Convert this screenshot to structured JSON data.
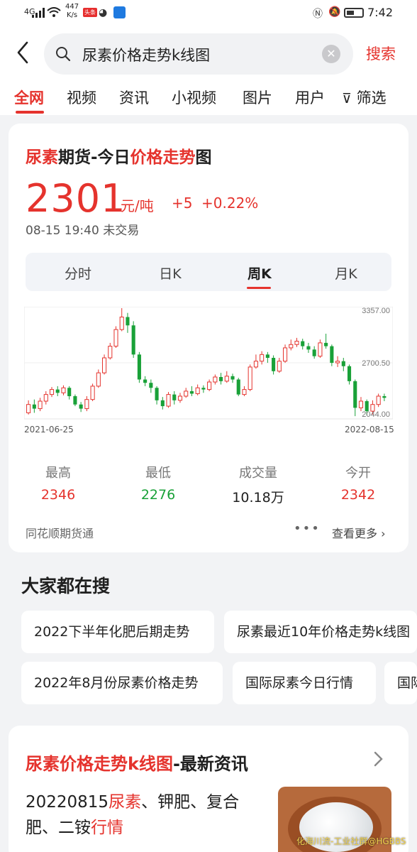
{
  "status_bar": {
    "signal_label": "4G",
    "speed_value": "447",
    "speed_unit": "K/s",
    "badge": "头条",
    "time": "7:42"
  },
  "search": {
    "query": "尿素价格走势k线图",
    "button": "搜索"
  },
  "tabs": [
    "全网",
    "视频",
    "资讯",
    "小视频",
    "图片",
    "用户"
  ],
  "filter_label": "筛选",
  "quote_card": {
    "title_parts": [
      "尿素",
      "期货-今日",
      "价格走势",
      "图"
    ],
    "price": "2301",
    "unit": "元/吨",
    "change": "+5",
    "change_pct": "+0.22%",
    "timestamp": "08-15 19:40 未交易",
    "segments": [
      "分时",
      "日K",
      "周K",
      "月K"
    ],
    "active_segment": "周K",
    "source": "同花顺期货通",
    "more": "查看更多",
    "stats": [
      {
        "label": "最高",
        "value": "2346",
        "color": "red"
      },
      {
        "label": "最低",
        "value": "2276",
        "color": "green"
      },
      {
        "label": "成交量",
        "value": "10.18万",
        "color": "black"
      },
      {
        "label": "今开",
        "value": "2342",
        "color": "red"
      }
    ]
  },
  "chart_data": {
    "type": "candlestick",
    "x_start": "2021-06-25",
    "x_end": "2022-08-15",
    "y_ticks": [
      "3357.00",
      "2700.50",
      "2044.00"
    ],
    "ylim": [
      2044,
      3357
    ],
    "colors": {
      "up": "#e5332d",
      "down": "#19a138"
    },
    "candles": [
      {
        "o": 2100,
        "c": 2200,
        "h": 2250,
        "l": 2080
      },
      {
        "o": 2200,
        "c": 2150,
        "h": 2260,
        "l": 2100
      },
      {
        "o": 2150,
        "c": 2240,
        "h": 2280,
        "l": 2120
      },
      {
        "o": 2240,
        "c": 2320,
        "h": 2360,
        "l": 2200
      },
      {
        "o": 2320,
        "c": 2380,
        "h": 2410,
        "l": 2290
      },
      {
        "o": 2380,
        "c": 2340,
        "h": 2420,
        "l": 2300
      },
      {
        "o": 2340,
        "c": 2400,
        "h": 2430,
        "l": 2310
      },
      {
        "o": 2400,
        "c": 2300,
        "h": 2420,
        "l": 2260
      },
      {
        "o": 2300,
        "c": 2200,
        "h": 2320,
        "l": 2180
      },
      {
        "o": 2200,
        "c": 2150,
        "h": 2230,
        "l": 2110
      },
      {
        "o": 2150,
        "c": 2260,
        "h": 2300,
        "l": 2120
      },
      {
        "o": 2260,
        "c": 2420,
        "h": 2450,
        "l": 2240
      },
      {
        "o": 2420,
        "c": 2580,
        "h": 2620,
        "l": 2400
      },
      {
        "o": 2580,
        "c": 2760,
        "h": 2800,
        "l": 2560
      },
      {
        "o": 2760,
        "c": 2900,
        "h": 2940,
        "l": 2740
      },
      {
        "o": 2900,
        "c": 3100,
        "h": 3140,
        "l": 2880
      },
      {
        "o": 3100,
        "c": 3250,
        "h": 3357,
        "l": 3080
      },
      {
        "o": 3250,
        "c": 3150,
        "h": 3300,
        "l": 3060
      },
      {
        "o": 3150,
        "c": 2800,
        "h": 3200,
        "l": 2760
      },
      {
        "o": 2800,
        "c": 2500,
        "h": 2830,
        "l": 2460
      },
      {
        "o": 2500,
        "c": 2460,
        "h": 2540,
        "l": 2420
      },
      {
        "o": 2460,
        "c": 2400,
        "h": 2500,
        "l": 2340
      },
      {
        "o": 2400,
        "c": 2250,
        "h": 2420,
        "l": 2200
      },
      {
        "o": 2250,
        "c": 2180,
        "h": 2290,
        "l": 2140
      },
      {
        "o": 2180,
        "c": 2320,
        "h": 2350,
        "l": 2160
      },
      {
        "o": 2320,
        "c": 2250,
        "h": 2360,
        "l": 2200
      },
      {
        "o": 2250,
        "c": 2300,
        "h": 2340,
        "l": 2220
      },
      {
        "o": 2300,
        "c": 2360,
        "h": 2400,
        "l": 2280
      },
      {
        "o": 2360,
        "c": 2330,
        "h": 2420,
        "l": 2300
      },
      {
        "o": 2330,
        "c": 2400,
        "h": 2440,
        "l": 2310
      },
      {
        "o": 2400,
        "c": 2380,
        "h": 2430,
        "l": 2340
      },
      {
        "o": 2380,
        "c": 2470,
        "h": 2500,
        "l": 2360
      },
      {
        "o": 2470,
        "c": 2530,
        "h": 2560,
        "l": 2440
      },
      {
        "o": 2530,
        "c": 2480,
        "h": 2580,
        "l": 2440
      },
      {
        "o": 2480,
        "c": 2540,
        "h": 2600,
        "l": 2460
      },
      {
        "o": 2540,
        "c": 2500,
        "h": 2570,
        "l": 2460
      },
      {
        "o": 2500,
        "c": 2320,
        "h": 2520,
        "l": 2300
      },
      {
        "o": 2320,
        "c": 2380,
        "h": 2420,
        "l": 2300
      },
      {
        "o": 2380,
        "c": 2650,
        "h": 2680,
        "l": 2360
      },
      {
        "o": 2650,
        "c": 2720,
        "h": 2800,
        "l": 2630
      },
      {
        "o": 2720,
        "c": 2800,
        "h": 2840,
        "l": 2680
      },
      {
        "o": 2800,
        "c": 2760,
        "h": 2830,
        "l": 2700
      },
      {
        "o": 2760,
        "c": 2600,
        "h": 2790,
        "l": 2560
      },
      {
        "o": 2600,
        "c": 2720,
        "h": 2760,
        "l": 2580
      },
      {
        "o": 2720,
        "c": 2880,
        "h": 2920,
        "l": 2700
      },
      {
        "o": 2880,
        "c": 2920,
        "h": 2980,
        "l": 2850
      },
      {
        "o": 2920,
        "c": 2960,
        "h": 3000,
        "l": 2890
      },
      {
        "o": 2960,
        "c": 2900,
        "h": 2990,
        "l": 2860
      },
      {
        "o": 2900,
        "c": 2860,
        "h": 2940,
        "l": 2820
      },
      {
        "o": 2860,
        "c": 2780,
        "h": 2900,
        "l": 2750
      },
      {
        "o": 2780,
        "c": 2940,
        "h": 2980,
        "l": 2760
      },
      {
        "o": 2940,
        "c": 2900,
        "h": 3050,
        "l": 2870
      },
      {
        "o": 2900,
        "c": 2700,
        "h": 2920,
        "l": 2660
      },
      {
        "o": 2700,
        "c": 2720,
        "h": 2780,
        "l": 2650
      },
      {
        "o": 2720,
        "c": 2660,
        "h": 2760,
        "l": 2600
      },
      {
        "o": 2660,
        "c": 2480,
        "h": 2680,
        "l": 2440
      },
      {
        "o": 2480,
        "c": 2160,
        "h": 2500,
        "l": 2060
      },
      {
        "o": 2160,
        "c": 2240,
        "h": 2290,
        "l": 2120
      },
      {
        "o": 2240,
        "c": 2120,
        "h": 2260,
        "l": 2070
      },
      {
        "o": 2120,
        "c": 2200,
        "h": 2250,
        "l": 2080
      },
      {
        "o": 2200,
        "c": 2300,
        "h": 2330,
        "l": 2170
      },
      {
        "o": 2300,
        "c": 2280,
        "h": 2330,
        "l": 2240
      }
    ]
  },
  "popular": {
    "title": "大家都在搜",
    "items": [
      "2022下半年化肥后期走势",
      "尿素最近10年价格走势k线图",
      "2022年8月份尿素价格走势",
      "国际尿素今日行情",
      "国际"
    ]
  },
  "news": {
    "title_hl": "尿素价格走势k线图",
    "title_rest": "-最新资讯",
    "headline_parts": [
      "20220815",
      "尿素",
      "、钾肥、复合肥、二铵",
      "行情"
    ],
    "watermark": "化海川流-工业社群@HGBBS"
  }
}
